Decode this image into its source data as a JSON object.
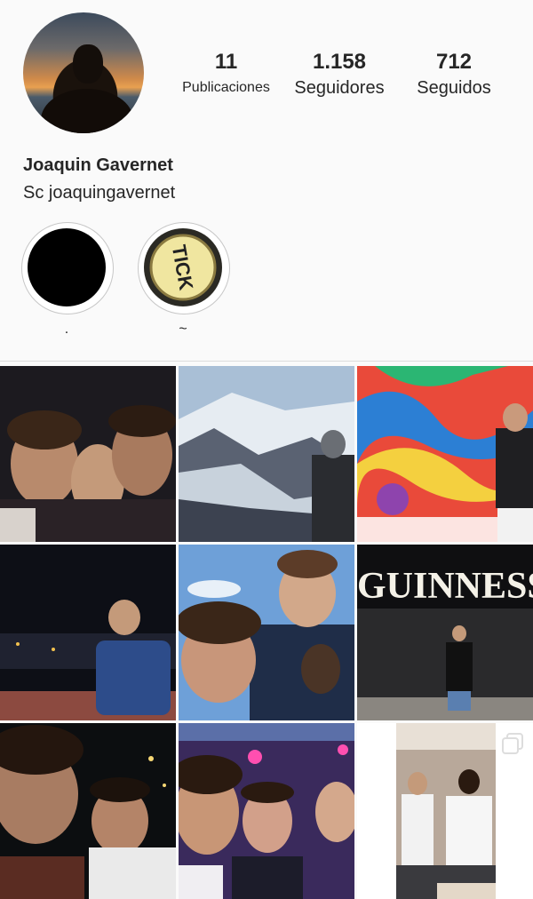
{
  "profile": {
    "name": "Joaquin Gavernet",
    "bio": "Sc joaquingavernet",
    "stats": [
      {
        "value": "11",
        "label": "Publicaciones"
      },
      {
        "value": "1.158",
        "label": "Seguidores"
      },
      {
        "value": "712",
        "label": "Seguidos"
      }
    ]
  },
  "highlights": [
    {
      "label": "."
    },
    {
      "label": "~",
      "badge_text": "TICK"
    }
  ],
  "grid": {
    "tile_text": {
      "guinness": "GUINNESS"
    }
  },
  "colors": {
    "background": "#fafafa",
    "text": "#262626",
    "divider": "#dbdbdb"
  }
}
